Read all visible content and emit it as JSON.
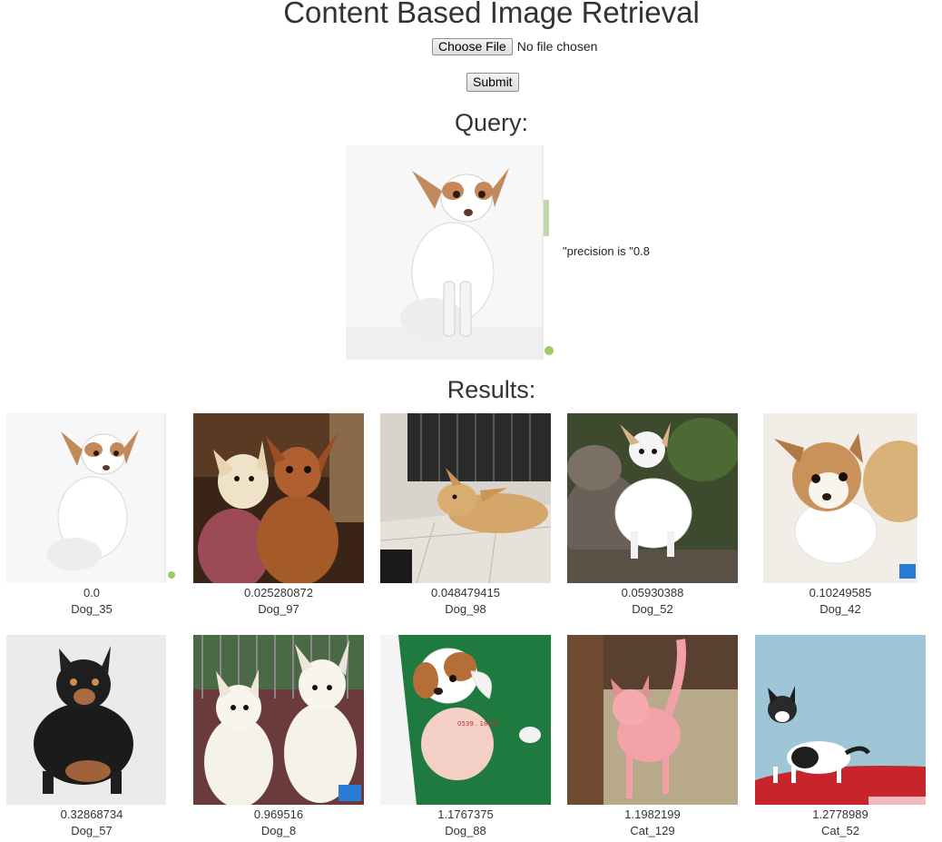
{
  "page": {
    "title": "Content Based Image Retrieval"
  },
  "upload": {
    "choose_label": "Choose File",
    "status_text": "No file chosen",
    "submit_label": "Submit"
  },
  "query": {
    "heading": "Query:",
    "image_subject": "chihuahua-white-tan",
    "precision_text": "\"precision is \"0.8"
  },
  "results": {
    "heading": "Results:",
    "items": [
      {
        "score": "0.0",
        "label": "Dog_35",
        "subject": "chihuahua-white-tan"
      },
      {
        "score": "0.025280872",
        "label": "Dog_97",
        "subject": "two-chihuahuas"
      },
      {
        "score": "0.048479415",
        "label": "Dog_98",
        "subject": "tan-chihuahua-tile"
      },
      {
        "score": "0.05930388",
        "label": "Dog_52",
        "subject": "white-chihuahua-rocks"
      },
      {
        "score": "0.10249585",
        "label": "Dog_42",
        "subject": "tan-white-puppy"
      },
      {
        "score": "0.32868734",
        "label": "Dog_57",
        "subject": "black-tan-chihuahua"
      },
      {
        "score": "0.969516",
        "label": "Dog_8",
        "subject": "two-white-spitz"
      },
      {
        "score": "1.1767375",
        "label": "Dog_88",
        "subject": "jack-russell-puppy"
      },
      {
        "score": "1.1982199",
        "label": "Cat_129",
        "subject": "pink-cat"
      },
      {
        "score": "1.2778989",
        "label": "Cat_52",
        "subject": "black-white-kitten"
      }
    ]
  },
  "colors": {
    "text": "#333333",
    "button_border": "#8f8f8f"
  }
}
